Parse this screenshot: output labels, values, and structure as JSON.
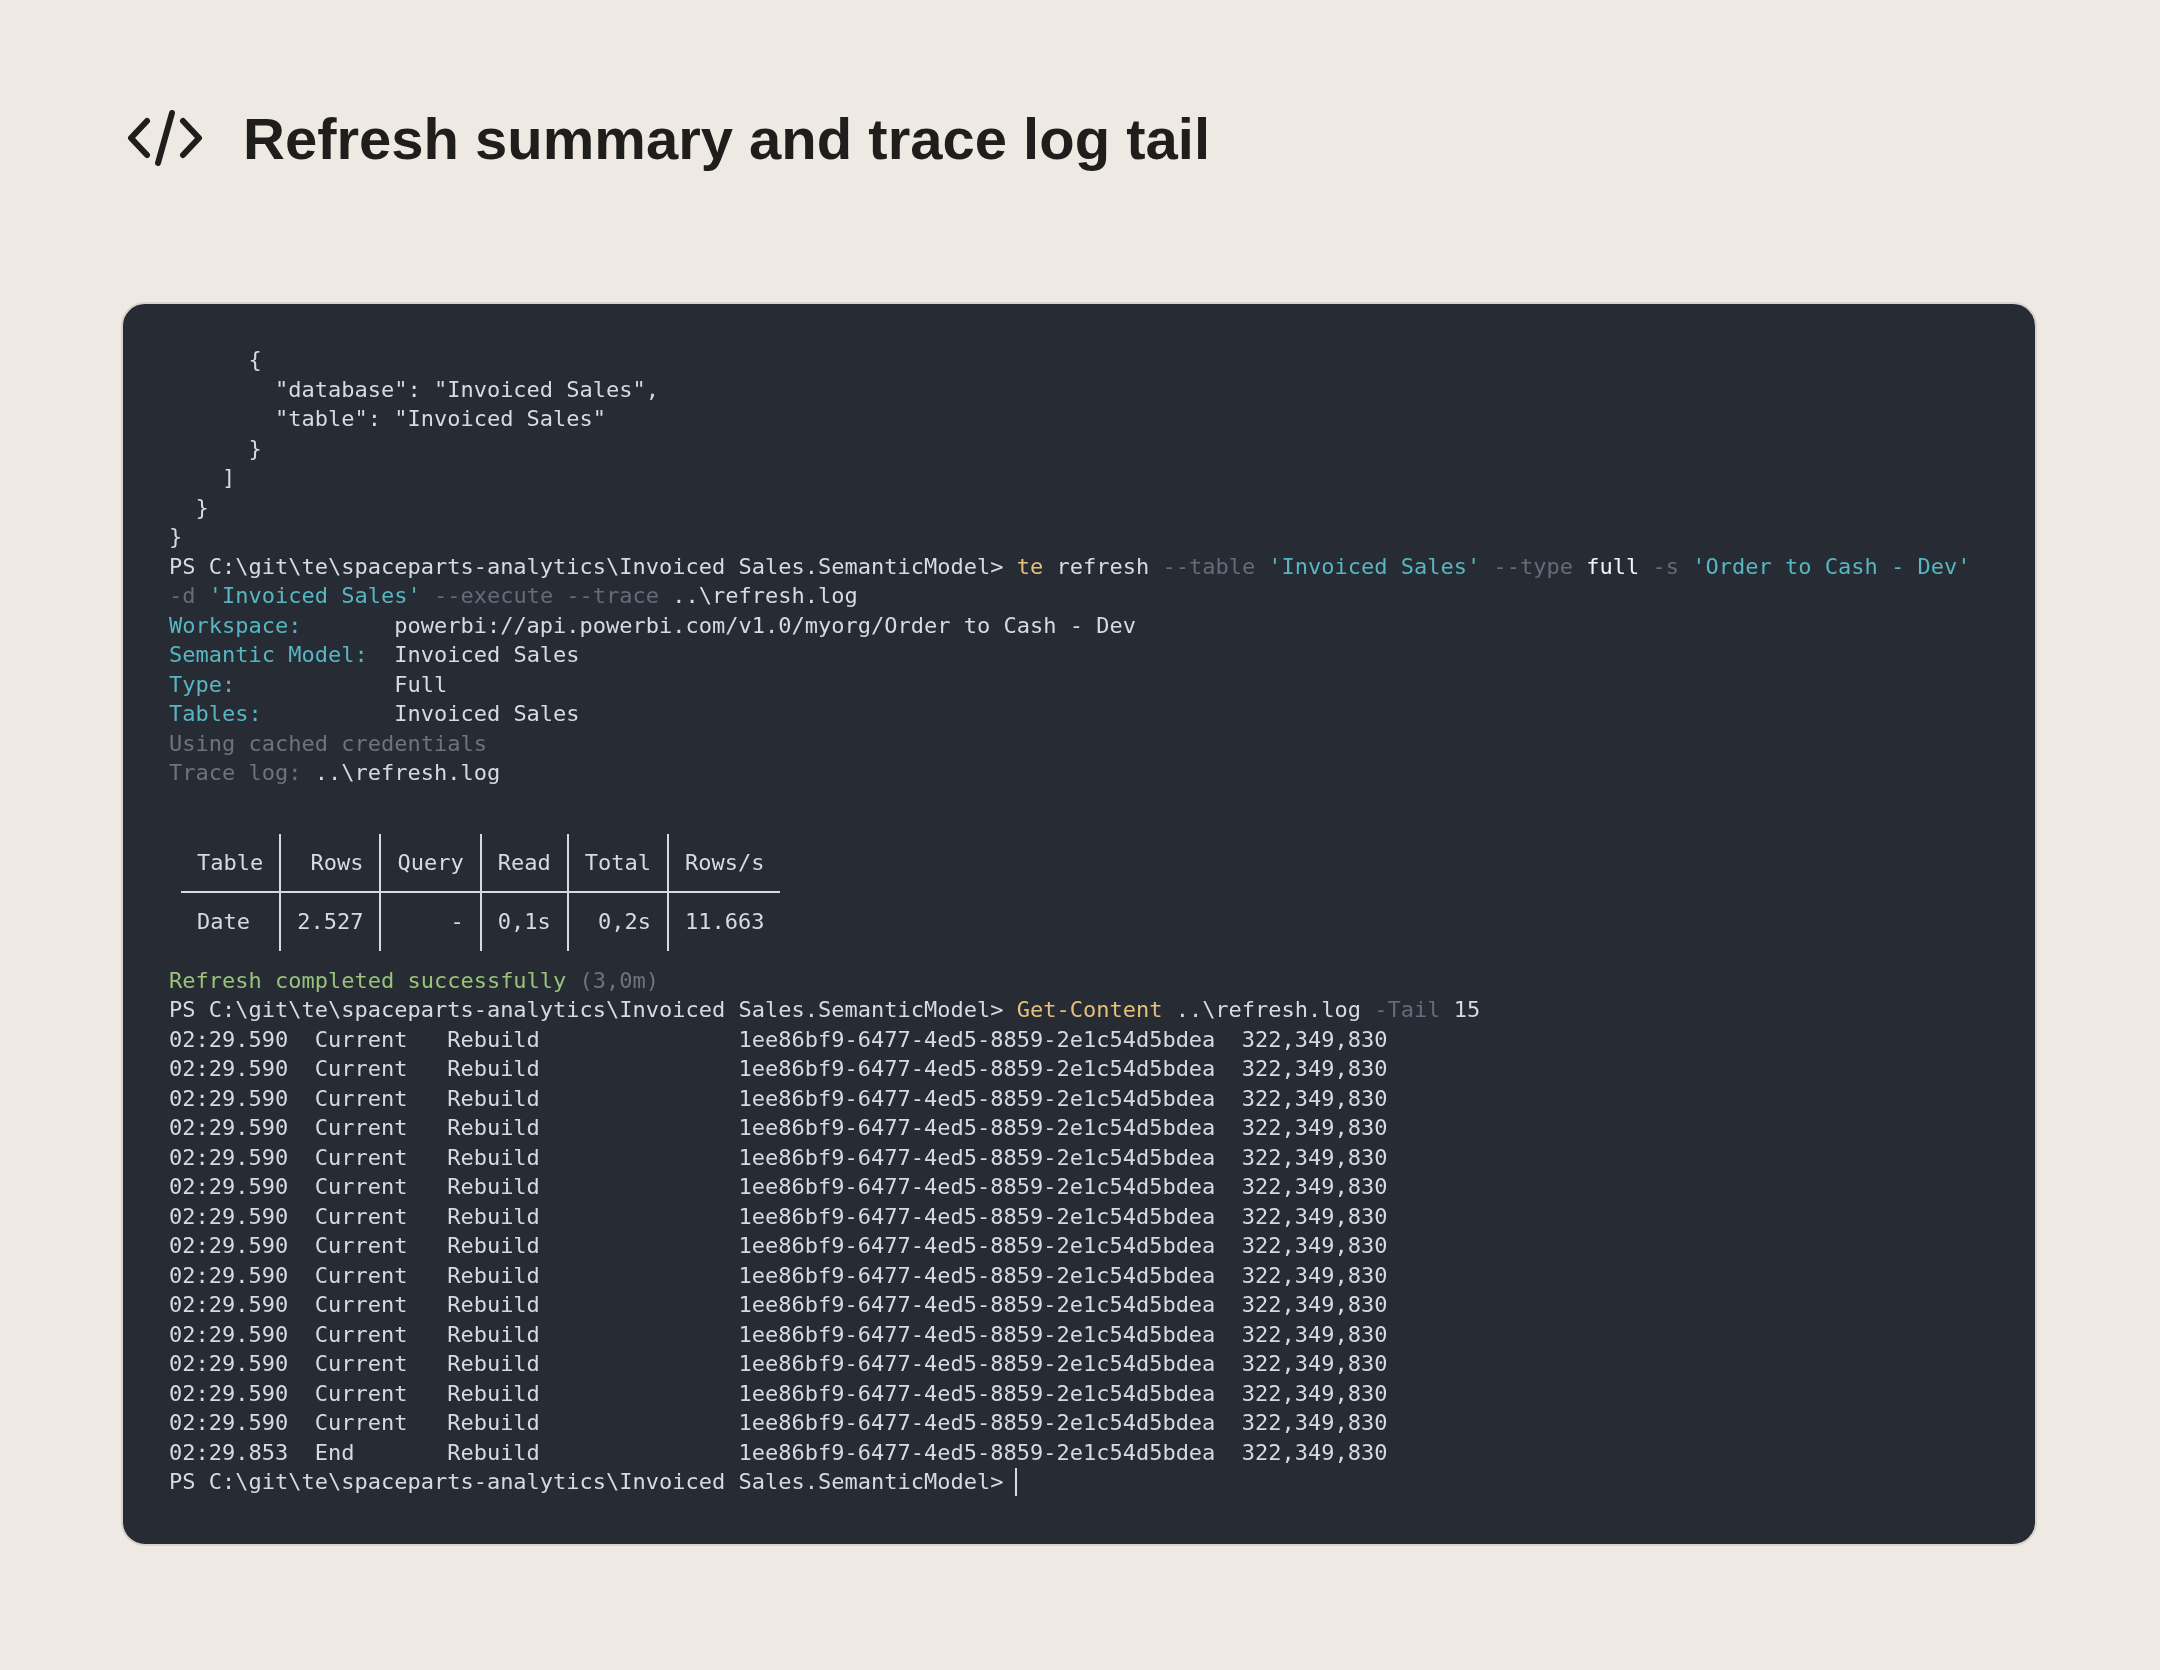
{
  "header": {
    "title": "Refresh summary and trace log tail"
  },
  "terminal": {
    "output_before": [
      {
        "segments": [
          {
            "text": "      {",
            "kind": "plain"
          }
        ]
      },
      {
        "segments": [
          {
            "text": "        \"database\": \"Invoiced Sales\",",
            "kind": "plain"
          }
        ]
      },
      {
        "segments": [
          {
            "text": "        \"table\": \"Invoiced Sales\"",
            "kind": "plain"
          }
        ]
      },
      {
        "segments": [
          {
            "text": "      }",
            "kind": "plain"
          }
        ]
      },
      {
        "segments": [
          {
            "text": "    ]",
            "kind": "plain"
          }
        ]
      },
      {
        "segments": [
          {
            "text": "  }",
            "kind": "plain"
          }
        ]
      },
      {
        "segments": [
          {
            "text": "}",
            "kind": "plain"
          }
        ]
      },
      {
        "segments": [
          {
            "text": "PS C:\\git\\te\\spaceparts-analytics\\Invoiced Sales.SemanticModel> ",
            "kind": "plain"
          },
          {
            "text": "te",
            "kind": "command"
          },
          {
            "text": " refresh ",
            "kind": "plain"
          },
          {
            "text": "--table",
            "kind": "flag"
          },
          {
            "text": " 'Invoiced Sales' ",
            "kind": "string"
          },
          {
            "text": "--type",
            "kind": "flag"
          },
          {
            "text": " full ",
            "kind": "bright"
          },
          {
            "text": "-s",
            "kind": "flag"
          },
          {
            "text": " 'Order to Cash - Dev'",
            "kind": "string"
          }
        ]
      },
      {
        "segments": [
          {
            "text": "-d",
            "kind": "flag"
          },
          {
            "text": " 'Invoiced Sales' ",
            "kind": "string"
          },
          {
            "text": "--execute --trace",
            "kind": "flag"
          },
          {
            "text": " ..\\refresh.log",
            "kind": "plain"
          }
        ]
      },
      {
        "segments": [
          {
            "text": "Workspace:",
            "kind": "label"
          },
          {
            "text": "       powerbi://api.powerbi.com/v1.0/myorg/Order to Cash - Dev",
            "kind": "plain"
          }
        ]
      },
      {
        "segments": [
          {
            "text": "Semantic Model:",
            "kind": "label"
          },
          {
            "text": "  Invoiced Sales",
            "kind": "plain"
          }
        ]
      },
      {
        "segments": [
          {
            "text": "Type:",
            "kind": "label"
          },
          {
            "text": "            Full",
            "kind": "plain"
          }
        ]
      },
      {
        "segments": [
          {
            "text": "Tables:",
            "kind": "label"
          },
          {
            "text": "          Invoiced Sales",
            "kind": "plain"
          }
        ]
      },
      {
        "segments": [
          {
            "text": "Using cached credentials",
            "kind": "muted"
          }
        ]
      },
      {
        "segments": [
          {
            "text": "Trace log:",
            "kind": "muted"
          },
          {
            "text": " ..\\refresh.log",
            "kind": "plain"
          }
        ]
      }
    ],
    "summary_table": {
      "columns": [
        "Table",
        "Rows",
        "Query",
        "Read",
        "Total",
        "Rows/s"
      ],
      "rows": [
        [
          "Date",
          "2.527",
          "-",
          "0,1s",
          "0,2s",
          "11.663"
        ]
      ]
    },
    "output_after": [
      {
        "segments": [
          {
            "text": "Refresh completed successfully",
            "kind": "success"
          },
          {
            "text": " (3,0m)",
            "kind": "muted"
          }
        ]
      },
      {
        "segments": [
          {
            "text": "PS C:\\git\\te\\spaceparts-analytics\\Invoiced Sales.SemanticModel> ",
            "kind": "plain"
          },
          {
            "text": "Get-Content",
            "kind": "command"
          },
          {
            "text": " ..\\refresh.log ",
            "kind": "plain"
          },
          {
            "text": "-Tail",
            "kind": "flag"
          },
          {
            "text": " 15",
            "kind": "plain"
          }
        ]
      },
      {
        "segments": [
          {
            "text": "02:29.590  Current   Rebuild               1ee86bf9-6477-4ed5-8859-2e1c54d5bdea  322,349,830",
            "kind": "plain"
          }
        ]
      },
      {
        "segments": [
          {
            "text": "02:29.590  Current   Rebuild               1ee86bf9-6477-4ed5-8859-2e1c54d5bdea  322,349,830",
            "kind": "plain"
          }
        ]
      },
      {
        "segments": [
          {
            "text": "02:29.590  Current   Rebuild               1ee86bf9-6477-4ed5-8859-2e1c54d5bdea  322,349,830",
            "kind": "plain"
          }
        ]
      },
      {
        "segments": [
          {
            "text": "02:29.590  Current   Rebuild               1ee86bf9-6477-4ed5-8859-2e1c54d5bdea  322,349,830",
            "kind": "plain"
          }
        ]
      },
      {
        "segments": [
          {
            "text": "02:29.590  Current   Rebuild               1ee86bf9-6477-4ed5-8859-2e1c54d5bdea  322,349,830",
            "kind": "plain"
          }
        ]
      },
      {
        "segments": [
          {
            "text": "02:29.590  Current   Rebuild               1ee86bf9-6477-4ed5-8859-2e1c54d5bdea  322,349,830",
            "kind": "plain"
          }
        ]
      },
      {
        "segments": [
          {
            "text": "02:29.590  Current   Rebuild               1ee86bf9-6477-4ed5-8859-2e1c54d5bdea  322,349,830",
            "kind": "plain"
          }
        ]
      },
      {
        "segments": [
          {
            "text": "02:29.590  Current   Rebuild               1ee86bf9-6477-4ed5-8859-2e1c54d5bdea  322,349,830",
            "kind": "plain"
          }
        ]
      },
      {
        "segments": [
          {
            "text": "02:29.590  Current   Rebuild               1ee86bf9-6477-4ed5-8859-2e1c54d5bdea  322,349,830",
            "kind": "plain"
          }
        ]
      },
      {
        "segments": [
          {
            "text": "02:29.590  Current   Rebuild               1ee86bf9-6477-4ed5-8859-2e1c54d5bdea  322,349,830",
            "kind": "plain"
          }
        ]
      },
      {
        "segments": [
          {
            "text": "02:29.590  Current   Rebuild               1ee86bf9-6477-4ed5-8859-2e1c54d5bdea  322,349,830",
            "kind": "plain"
          }
        ]
      },
      {
        "segments": [
          {
            "text": "02:29.590  Current   Rebuild               1ee86bf9-6477-4ed5-8859-2e1c54d5bdea  322,349,830",
            "kind": "plain"
          }
        ]
      },
      {
        "segments": [
          {
            "text": "02:29.590  Current   Rebuild               1ee86bf9-6477-4ed5-8859-2e1c54d5bdea  322,349,830",
            "kind": "plain"
          }
        ]
      },
      {
        "segments": [
          {
            "text": "02:29.590  Current   Rebuild               1ee86bf9-6477-4ed5-8859-2e1c54d5bdea  322,349,830",
            "kind": "plain"
          }
        ]
      },
      {
        "segments": [
          {
            "text": "02:29.853  End       Rebuild               1ee86bf9-6477-4ed5-8859-2e1c54d5bdea  322,349,830",
            "kind": "plain"
          }
        ]
      }
    ],
    "prompt": "PS C:\\git\\te\\spaceparts-analytics\\Invoiced Sales.SemanticModel>"
  }
}
